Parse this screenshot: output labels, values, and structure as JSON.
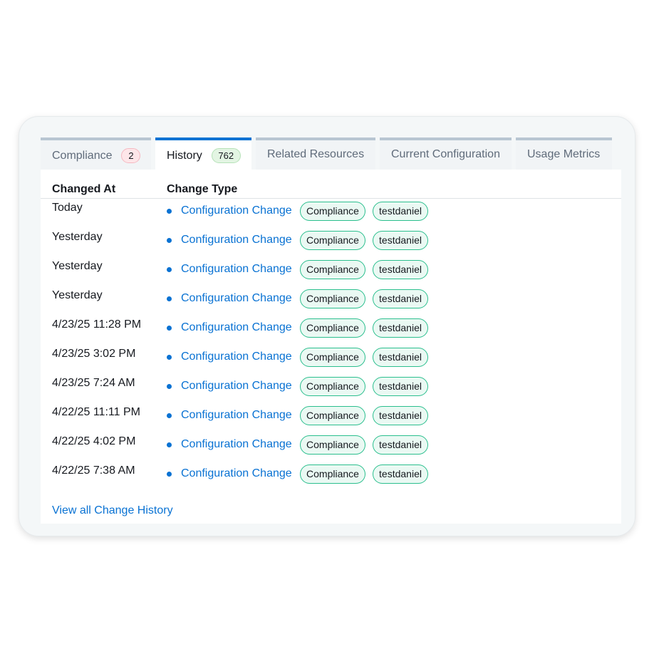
{
  "tabs": [
    {
      "label": "Compliance",
      "badge": "2",
      "badge_color": "#fde6e9"
    },
    {
      "label": "History",
      "badge": "762",
      "badge_color": "#e3f5e3",
      "active": true
    },
    {
      "label": "Related Resources"
    },
    {
      "label": "Current Configuration"
    },
    {
      "label": "Usage Metrics"
    }
  ],
  "table": {
    "columns": [
      "Changed At",
      "Change Type"
    ],
    "rows": [
      {
        "changed_at": "Today",
        "change_type": "Configuration Change",
        "tags": [
          "Compliance",
          "testdaniel"
        ]
      },
      {
        "changed_at": "Yesterday",
        "change_type": "Configuration Change",
        "tags": [
          "Compliance",
          "testdaniel"
        ]
      },
      {
        "changed_at": "Yesterday",
        "change_type": "Configuration Change",
        "tags": [
          "Compliance",
          "testdaniel"
        ]
      },
      {
        "changed_at": "Yesterday",
        "change_type": "Configuration Change",
        "tags": [
          "Compliance",
          "testdaniel"
        ]
      },
      {
        "changed_at": "4/23/25 11:28 PM",
        "change_type": "Configuration Change",
        "tags": [
          "Compliance",
          "testdaniel"
        ]
      },
      {
        "changed_at": "4/23/25 3:02 PM",
        "change_type": "Configuration Change",
        "tags": [
          "Compliance",
          "testdaniel"
        ]
      },
      {
        "changed_at": "4/23/25 7:24 AM",
        "change_type": "Configuration Change",
        "tags": [
          "Compliance",
          "testdaniel"
        ]
      },
      {
        "changed_at": "4/22/25 11:11 PM",
        "change_type": "Configuration Change",
        "tags": [
          "Compliance",
          "testdaniel"
        ]
      },
      {
        "changed_at": "4/22/25 4:02 PM",
        "change_type": "Configuration Change",
        "tags": [
          "Compliance",
          "testdaniel"
        ]
      },
      {
        "changed_at": "4/22/25 7:38 AM",
        "change_type": "Configuration Change",
        "tags": [
          "Compliance",
          "testdaniel"
        ]
      }
    ]
  },
  "footer": {
    "link_label": "View all Change History"
  },
  "colors": {
    "accent": "#0972d3",
    "tag_border": "#2bbf8e",
    "tag_fill": "#eaf9f3"
  }
}
